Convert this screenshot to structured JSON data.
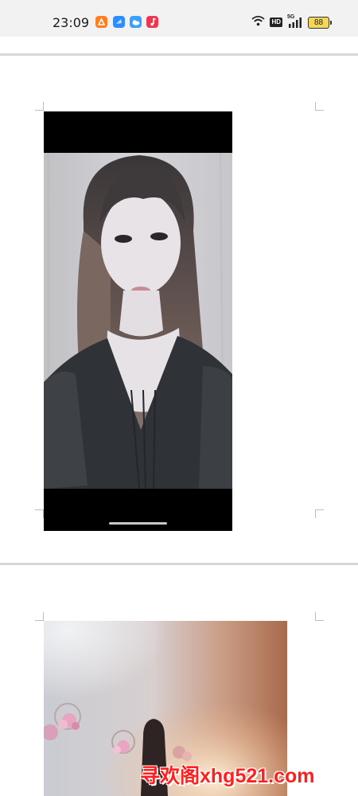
{
  "status_bar": {
    "time": "23:09",
    "network": "5G",
    "network_badge": "HD",
    "battery": "88",
    "icons": [
      "orange-app-icon",
      "blue-app-icon",
      "weather-app-icon",
      "music-app-icon",
      "wifi-icon",
      "hd-icon",
      "signal-icon",
      "battery-icon"
    ]
  },
  "watermark": {
    "text": "寻欢阁xhg521.com"
  },
  "colors": {
    "watermark": "#ff1f1f",
    "status_bar_bg": "#f2f2f2",
    "page_separator": "#d7d7d7"
  },
  "pages": [
    {
      "content": "photo-woman-portrait-phone-screenshot"
    },
    {
      "content": "photo-room-with-flower-decorations"
    }
  ]
}
